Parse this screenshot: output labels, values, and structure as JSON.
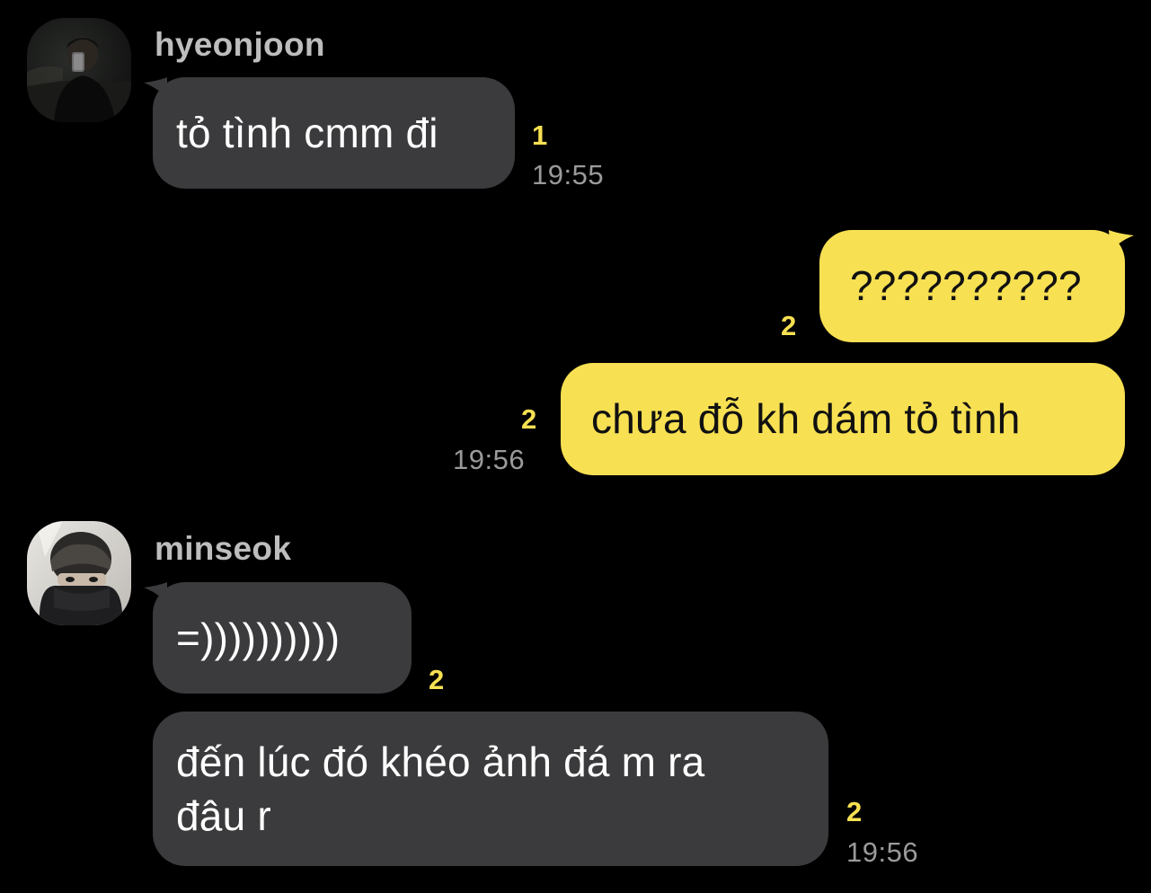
{
  "colors": {
    "background": "#000000",
    "incoming_bubble": "#3b3b3d",
    "outgoing_bubble": "#f7e052",
    "unread_count": "#f7e052",
    "timestamp": "#9a9a9a",
    "sender_name": "#bdbdbd"
  },
  "messages": {
    "group1": {
      "sender": "hyeonjoon",
      "avatar_icon": "user-avatar-photo-icon",
      "m1": {
        "text": "tỏ tình cmm đi",
        "unread": "1",
        "time": "19:55"
      }
    },
    "group2": {
      "m1": {
        "text": "??????????",
        "unread": "2"
      },
      "m2": {
        "text": "chưa đỗ kh dám tỏ tình",
        "unread": "2",
        "time": "19:56"
      }
    },
    "group3": {
      "sender": "minseok",
      "avatar_icon": "user-avatar-photo-icon",
      "m1": {
        "text": "=))))))))))",
        "unread": "2"
      },
      "m2": {
        "line1": "đến lúc đó khéo ảnh đá m ra",
        "line2": "đâu r",
        "unread": "2",
        "time": "19:56"
      }
    }
  }
}
